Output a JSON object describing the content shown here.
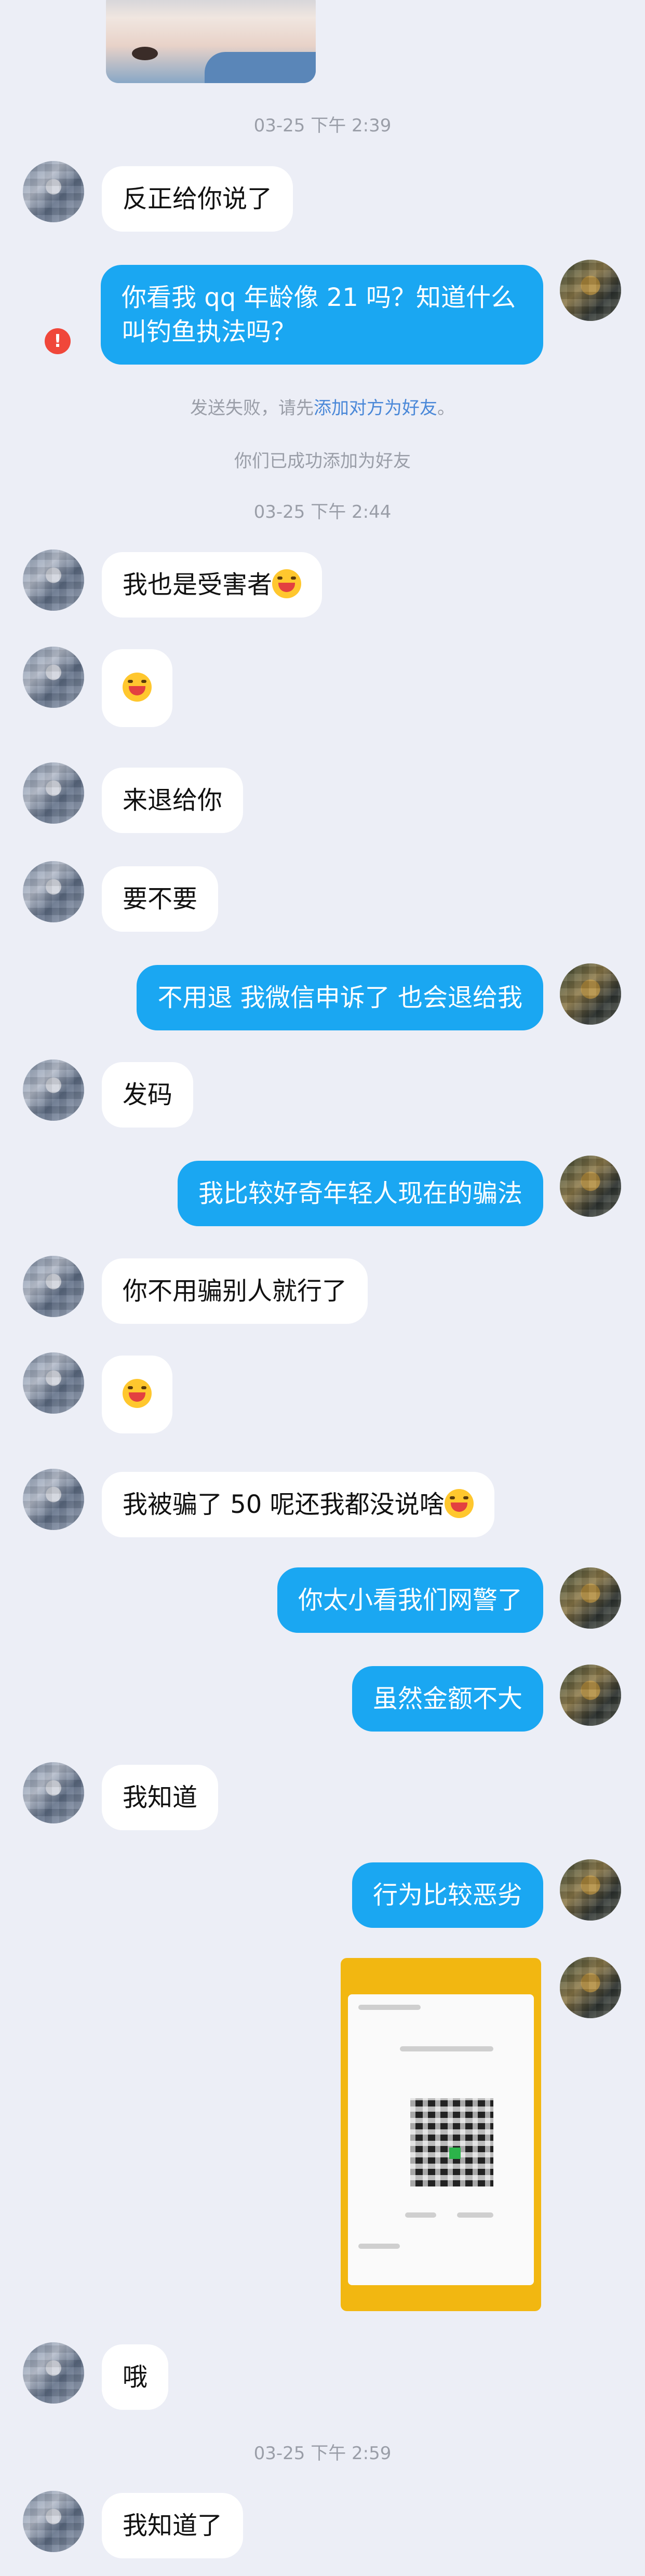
{
  "messages": {
    "ts1": "03-25 下午 2:39",
    "m1": "反正给你说了",
    "m2": "你看我 qq 年龄像 21 吗？知道什么叫钓鱼执法吗？",
    "failed_prefix": "发送失败，请先",
    "failed_link": "添加对方为好友",
    "failed_suffix": "。",
    "added_friend": "你们已成功添加为好友",
    "ts2": "03-25 下午 2:44",
    "m3": "我也是受害者",
    "m5": "来退给你",
    "m6": "要不要",
    "m7": "不用退  我微信申诉了 也会退给我",
    "m8": "发码",
    "m9": "我比较好奇年轻人现在的骗法",
    "m10": "你不用骗别人就行了",
    "m12": "我被骗了 50 呢还我都没说啥",
    "m13": "你太小看我们网警了",
    "m14": "虽然金额不大",
    "m15": "我知道",
    "m16": "行为比较恶劣",
    "m17": "哦",
    "ts3": "03-25 下午 2:59",
    "m18": "我知道了",
    "error_mark": "!"
  },
  "colors": {
    "background": "#eceef6",
    "self_bubble": "#1aa7f2",
    "other_bubble": "#ffffff",
    "link": "#4a88d8",
    "error": "#f0473a"
  },
  "icons": {
    "emoji": "laughing-crying-emoji",
    "error": "send-failed-icon"
  }
}
